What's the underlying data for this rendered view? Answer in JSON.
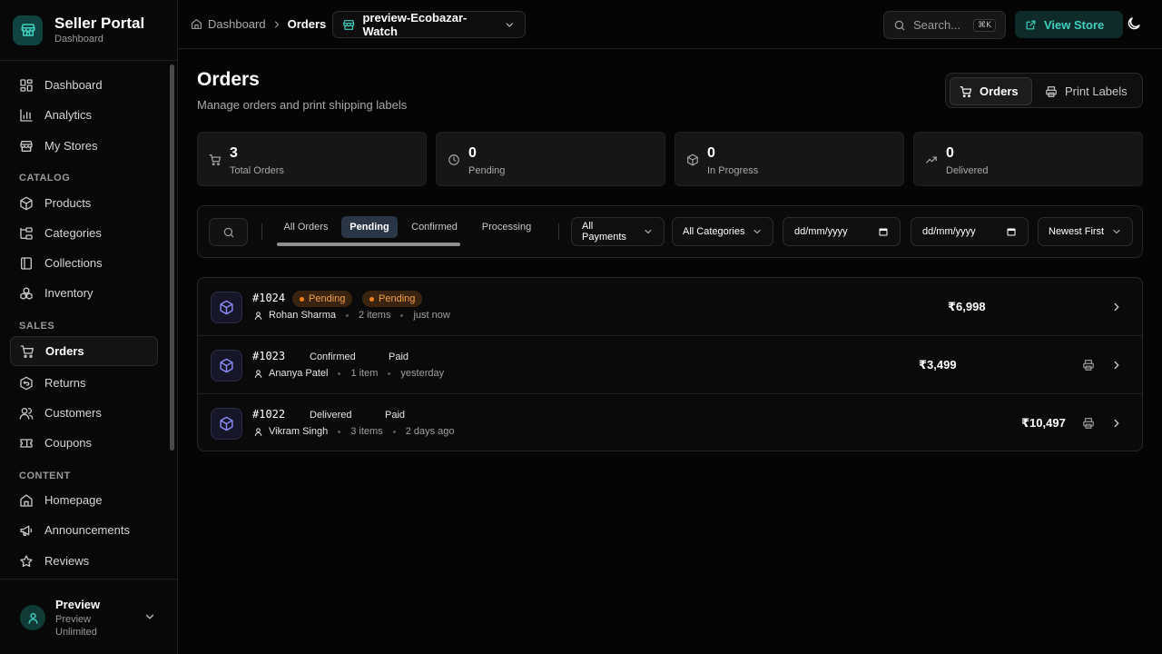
{
  "brand": {
    "title": "Seller Portal",
    "subtitle": "Dashboard"
  },
  "sidebar": {
    "items_main": [
      {
        "label": "Dashboard",
        "icon": "layout-dashboard-icon"
      },
      {
        "label": "Analytics",
        "icon": "bar-chart-icon"
      },
      {
        "label": "My Stores",
        "icon": "store-icon"
      }
    ],
    "catalog_label": "CATALOG",
    "items_catalog": [
      {
        "label": "Products",
        "icon": "package-icon"
      },
      {
        "label": "Categories",
        "icon": "folder-tree-icon"
      },
      {
        "label": "Collections",
        "icon": "book-icon"
      },
      {
        "label": "Inventory",
        "icon": "boxes-icon"
      }
    ],
    "sales_label": "SALES",
    "items_sales": [
      {
        "label": "Orders",
        "icon": "shopping-cart-icon",
        "active": true
      },
      {
        "label": "Returns",
        "icon": "return-icon"
      },
      {
        "label": "Customers",
        "icon": "users-icon"
      },
      {
        "label": "Coupons",
        "icon": "ticket-icon"
      }
    ],
    "content_label": "CONTENT",
    "items_content": [
      {
        "label": "Homepage",
        "icon": "home-icon"
      },
      {
        "label": "Announcements",
        "icon": "megaphone-icon"
      },
      {
        "label": "Reviews",
        "icon": "star-icon"
      }
    ]
  },
  "user": {
    "name": "Preview",
    "role": "Preview Unlimited"
  },
  "topbar": {
    "breadcrumb_root": "Dashboard",
    "breadcrumb_current": "Orders",
    "store_name": "preview-Ecobazar-Watch",
    "search_placeholder": "Search...",
    "search_shortcut": "⌘K",
    "view_store_label": "View Store"
  },
  "page": {
    "title": "Orders",
    "subtitle": "Manage orders and print shipping labels",
    "seg_orders": "Orders",
    "seg_print": "Print Labels"
  },
  "stats": [
    {
      "value": "3",
      "label": "Total Orders",
      "icon": "cart-icon"
    },
    {
      "value": "0",
      "label": "Pending",
      "icon": "clock-icon"
    },
    {
      "value": "0",
      "label": "In Progress",
      "icon": "package-icon"
    },
    {
      "value": "0",
      "label": "Delivered",
      "icon": "trending-up-icon"
    }
  ],
  "filters": {
    "tabs": [
      "All Orders",
      "Pending",
      "Confirmed",
      "Processing"
    ],
    "active_tab": "Pending",
    "payments": "All Payments",
    "categories": "All Categories",
    "date_from": "dd/mm/yyyy",
    "date_to": "dd/mm/yyyy",
    "sort": "Newest First"
  },
  "orders": [
    {
      "id": "#1024",
      "status": "Pending",
      "payment": "Pending",
      "customer": "Rohan Sharma",
      "items": "2 items",
      "time": "just now",
      "amount": "₹6,998"
    },
    {
      "id": "#1023",
      "status": "Confirmed",
      "payment": "Paid",
      "customer": "Ananya Patel",
      "items": "1 item",
      "time": "yesterday",
      "amount": "₹3,499"
    },
    {
      "id": "#1022",
      "status": "Delivered",
      "payment": "Paid",
      "customer": "Vikram Singh",
      "items": "3 items",
      "time": "2 days ago",
      "amount": "₹10,497"
    }
  ],
  "colors": {
    "accent": "#3fd0c0",
    "pending": "#f57f1c",
    "package": "#8b8cf8"
  }
}
